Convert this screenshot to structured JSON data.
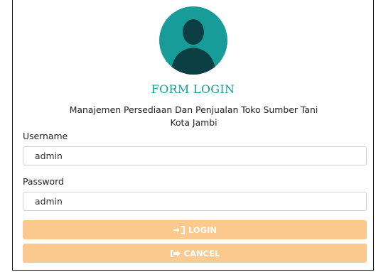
{
  "form": {
    "title": "FORM LOGIN",
    "subtitle_line1": "Manajemen Persediaan Dan Penjualan Toko Sumber Tani",
    "subtitle_line2": "Kota Jambi",
    "username_label": "Username",
    "username_value": "admin",
    "password_label": "Password",
    "password_value": "admin",
    "login_label": "LOGIN",
    "cancel_label": "CANCEL"
  },
  "icons": {
    "avatar": "user-avatar-icon",
    "login": "sign-in-icon",
    "cancel": "sign-out-icon"
  },
  "colors": {
    "accent": "#189c99",
    "button": "#fcc98f",
    "button_text": "#ffffff"
  }
}
